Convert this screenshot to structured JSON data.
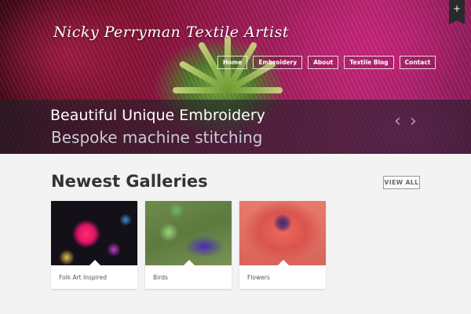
{
  "site": {
    "title": "Nicky Perryman Textile Artist"
  },
  "nav": [
    {
      "label": "Home"
    },
    {
      "label": "Embroidery"
    },
    {
      "label": "About"
    },
    {
      "label": "Textile Blog"
    },
    {
      "label": "Contact"
    }
  ],
  "corner_button": {
    "icon": "plus-icon",
    "label": "+"
  },
  "slider": {
    "title": "Beautiful Unique Embroidery",
    "subtitle": "Bespoke machine stitching",
    "prev_glyph": "‹",
    "next_glyph": "›"
  },
  "galleries": {
    "heading": "Newest Galleries",
    "view_all": "VIEW ALL",
    "items": [
      {
        "label": "Folk Art Inspired"
      },
      {
        "label": "Birds"
      },
      {
        "label": "Flowers"
      }
    ]
  }
}
